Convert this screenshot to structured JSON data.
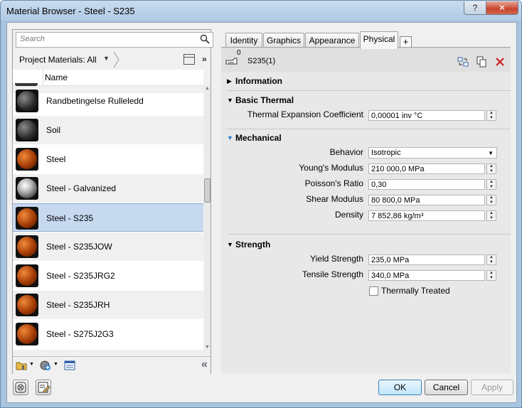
{
  "window": {
    "title": "Material Browser - Steel - S235",
    "help_label": "?",
    "close_label": "✕"
  },
  "search": {
    "placeholder": "Search"
  },
  "project_bar": {
    "label": "Project Materials: All"
  },
  "list": {
    "column_header": "Name",
    "items": [
      {
        "name": "Randbetingelse Rulleledd",
        "swatch": "dark"
      },
      {
        "name": "Soil",
        "swatch": "dark"
      },
      {
        "name": "Steel",
        "swatch": "orange"
      },
      {
        "name": "Steel - Galvanized",
        "swatch": "silver"
      },
      {
        "name": "Steel - S235",
        "swatch": "orange",
        "selected": true
      },
      {
        "name": "Steel - S235JOW",
        "swatch": "orange"
      },
      {
        "name": "Steel - S235JRG2",
        "swatch": "orange"
      },
      {
        "name": "Steel - S235JRH",
        "swatch": "orange"
      },
      {
        "name": "Steel - S275J2G3",
        "swatch": "orange"
      }
    ]
  },
  "tabs": [
    {
      "label": "Identity"
    },
    {
      "label": "Graphics"
    },
    {
      "label": "Appearance"
    },
    {
      "label": "Physical",
      "active": true
    }
  ],
  "asset": {
    "name": "S235(1)",
    "users": "0"
  },
  "sections": {
    "information": {
      "title": "Information"
    },
    "basic_thermal": {
      "title": "Basic Thermal",
      "thermal_expansion": {
        "label": "Thermal Expansion Coefficient",
        "value": "0,00001 inv °C"
      }
    },
    "mechanical": {
      "title": "Mechanical",
      "behavior": {
        "label": "Behavior",
        "value": "Isotropic"
      },
      "youngs_modulus": {
        "label": "Young's Modulus",
        "value": "210 000,0 MPa"
      },
      "poissons_ratio": {
        "label": "Poisson's Ratio",
        "value": "0,30"
      },
      "shear_modulus": {
        "label": "Shear Modulus",
        "value": "80 800,0 MPa"
      },
      "density": {
        "label": "Density",
        "value": "7 852,86 kg/m³"
      }
    },
    "strength": {
      "title": "Strength",
      "yield_strength": {
        "label": "Yield Strength",
        "value": "235,0 MPa"
      },
      "tensile_strength": {
        "label": "Tensile Strength",
        "value": "340,0 MPa"
      },
      "thermally_treated": {
        "label": "Thermally Treated",
        "checked": false
      }
    }
  },
  "buttons": {
    "ok": "OK",
    "cancel": "Cancel",
    "apply": "Apply"
  },
  "colors": {
    "selection": "#c6d9ef",
    "accent": "#2a7ad5",
    "delete": "#d02020"
  }
}
